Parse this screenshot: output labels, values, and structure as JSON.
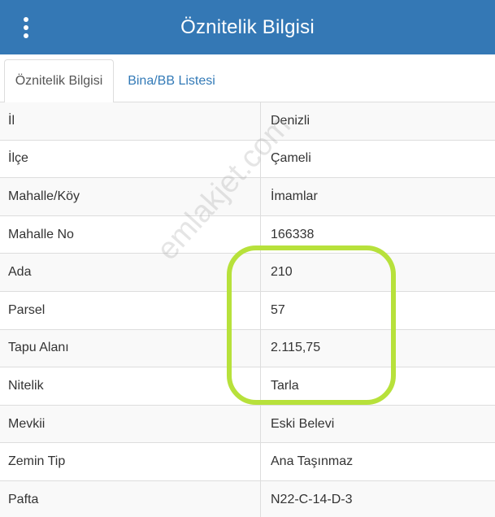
{
  "header": {
    "title": "Öznitelik Bilgisi"
  },
  "tabs": [
    {
      "label": "Öznitelik Bilgisi"
    },
    {
      "label": "Bina/BB Listesi"
    }
  ],
  "rows": [
    {
      "key": "İl",
      "value": "Denizli"
    },
    {
      "key": "İlçe",
      "value": "Çameli"
    },
    {
      "key": "Mahalle/Köy",
      "value": "İmamlar"
    },
    {
      "key": "Mahalle No",
      "value": "166338"
    },
    {
      "key": "Ada",
      "value": "210"
    },
    {
      "key": "Parsel",
      "value": "57"
    },
    {
      "key": "Tapu Alanı",
      "value": "2.115,75"
    },
    {
      "key": "Nitelik",
      "value": "Tarla"
    },
    {
      "key": "Mevkii",
      "value": "Eski Belevi"
    },
    {
      "key": "Zemin Tip",
      "value": "Ana Taşınmaz"
    },
    {
      "key": "Pafta",
      "value": "N22-C-14-D-3"
    }
  ],
  "watermark": "emlakjet.com",
  "colors": {
    "header_bg": "#3478b5",
    "link": "#337ab7",
    "highlight": "#b7e13b"
  }
}
